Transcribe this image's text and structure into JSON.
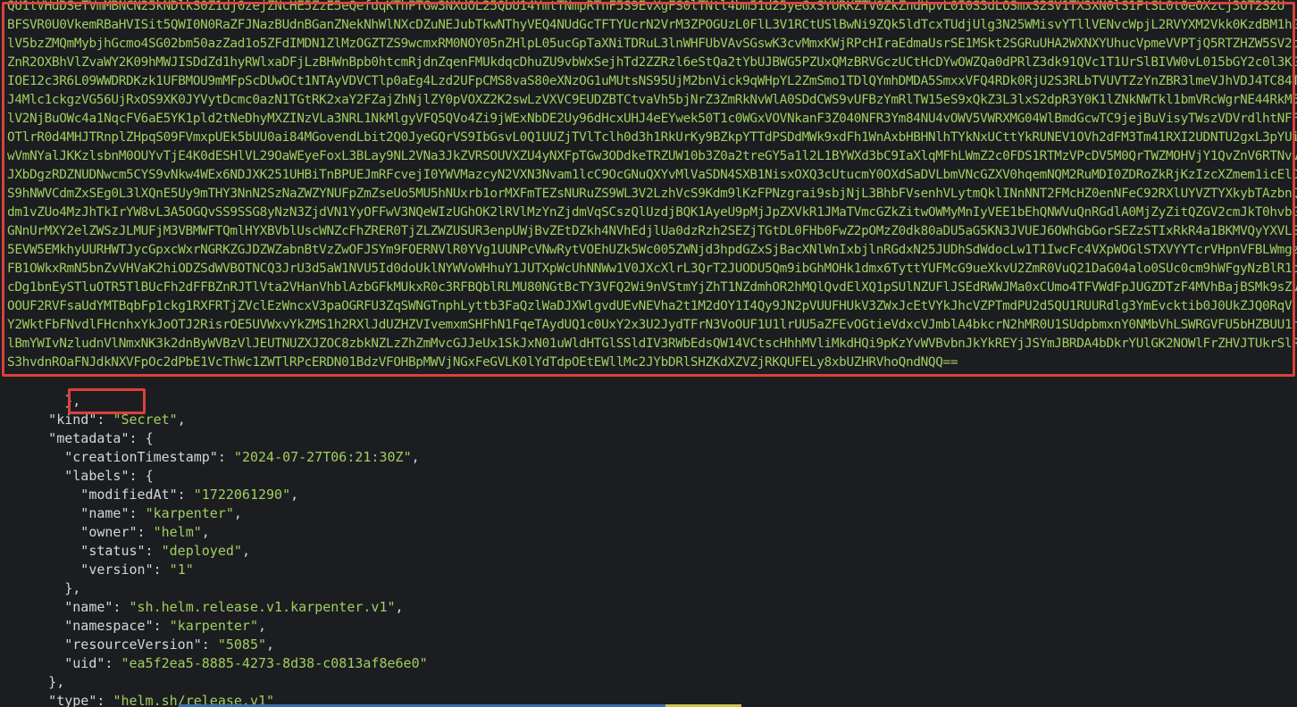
{
  "blob_lines": [
    "QU1tVHdDSeTVmMBNCN25kNDlkS0Z1dj0zejZNcHE5ZzE5eQefdqKThPTGw3NXdOL25QbU14YmtTNmpRTnF5S9EvXgFS0lTNtl4bm51d25yeGxSYURKZTV0ZkZndHpvL0I0S3dLOSmxS2SV1TX3XN0lS1FtSL0t0eOXzcj3OT2S2U",
    "BFSVR0U0VkemRBaHVISit5QWI0N0RaZFJNazBUdnBGanZNekNhWlNXcDZuNEJubTkwNThyVEQ4NUdGcTFTYUcrN2VrM3ZPOGUzL0FlL3V1RCtUSlBwNi9ZQk5ldTcxTUdjUlg3N25WMisvYTllVENvcWpjL2RVYXM2Vkk0KzdBM1hGeSt",
    "lV5bzZMQmMybjhGcmo4SG02bm50azZad1o5ZFdIMDN1ZlMzOGZTZS9wcmxRM0NOY05nZHlpL05ucGpTaXNiTDRuL3lnWHFUbVAvSGswK3cvMmxKWjRPcHIraEdmaUsrSE1MSkt2SGRuUHA2WXNXYUhucVpmeVVPTjQ5RTZHZW5SV2pGa",
    "ZnR2OXBhVlZvaWY2K09hMWJISDdZd1hyRWlxaDFjLzBHWnBpb0htcmRjdnZqenFMUkdqcDhuZU9vbWxSejhTd2ZZRzl6eStQa2tYbUJBWG5PZUxQMzBRVGczUCtHcDYwOWZQa0dPRlZ3dk91QVc1T1UrSlBIVW0vL015bGY2c0l3KGxhT",
    "IOE12c3R6L09WWDRDKzk1UFBMOU9mMFpScDUwOCt1NTAyVDVCTlp0aEg4Lzd2UFpCMS8vaS80eXNzOG1uMUtsNS95UjM2bnVick9qWHpYL2ZmSmo1TDlQYmhDMDA5SmxxVFQ4RDk0RjU2S3RLbTVUVTZzYnZBR3lmeVJhVDJ4TC84T3Q",
    "J4Mlc1ckgzVG56UjRxOS9XK0JYVytDcmc0azN1TGtRK2xaY2FZajZhNjlZY0pVOXZ2K2swLzVXVC9EUDZBTCtvaVh5bjNrZ3ZmRkNvWlA0SDdCWS9vUFBzYmRlTW15eS9xQkZ3L3lxS2dpR3Y0K1lZNkNWTkl1bmVRcWgrNE44RkM5S",
    "lV2NjBuOWc4a1NqcFV6aE5YK1pld2tNeDhyMXZINzVLa3NRL1NkMlgyVFQ5QVo4Zi9jWExNbDE2Uy96dHcxUHJ4eEYwek50T1c0WGxVOVNkanF3Z040NFR3Ym84NU4vOWV5VWRXMG04WlBmdGcwTC9jejBuVisyTWszVDVrdlhtNFFST",
    "OTlrR0d4MHJTRnplZHpqS09FVmxpUEk5bUU0ai84MGovendLbit2Q0JyeGQrVS9IbGsvL0Q1UUZjTVlTclh0d3h1RkUrKy9BZkpYTTdPSDdMWk9xdFh1WnAxbHBHNlhTYkNxUCttYkRUNEV1OVh2dFM3Tm41RXI2UDNTU2gxL3pYUi",
    "wVmNYalJKKzlsbnM0OUYvTjE4K0dESHlVL29OaWEyeFoxL3BLay9NL2VNa3JkZVRSOUVXZU4yNXFpTGw3ODdkeTRZUW10b3Z0a2treGY5a1l2L1BYWXd3bC9IaXlqMFhLWmZ2c0FDS1RTMzVPcDV5M0QrTWZMOHVjY1QvZnV6RTNvV",
    "JXbDgzRDZNUDNwcm5CYS9vNkw4WEx6NDJXK251UHBiTnBPUEJmRFcvejI0YWVMazcyN2VXN3Nvam1lcC9OcGNuQXYvMlVaSDN4SXB1NisxOXQ3cUtucmY0OXdSaDVLbmVNcGZXV0hqemNQM2RuMDI0ZDRoZkRjKzIzcXZmem1icElDR",
    "S9hNWVCdmZxSEg0L3lXQnE5Uy9mTHY3NnN2SzNaZWZYNUFpZmZseUo5MU5hNUxrb1orMXFmTEZsNURuZS9WL3V2LzhVcS9Kdm9lKzFPNzgrai9sbjNjL3BhbFVsenhVLytmQklINnNNT2FMcHZ0enNFeC92RXlUYVZTYXkybTAzbnQ",
    "dm1vZUo4MzJhTkIrYW8vL3A5OGQvSS9SSG8yNzN3ZjdVN1YyOFFwV3NQeWIzUGhOK2lRVlMzYnZjdmVqSCszQlUzdjBQK1AyeU9pMjJpZXVkR1JMaTVmcGZkZitwOWMyMnIyVEE1bEhQNWVuQnRGdlA0MjZyZitQZGV2cmJkT0hvbG",
    "GNnUrMXY2elZWSzJLMUFjM3VBMWFTQmlHYXBVblUscWNZcFhZRER0TjZLZWZUSUR3enpUWjBvZEtDZkh4NVhEdjlUa0dzRzh2SEZjTGtDL0FHb0FwZ2pOMzZ0dk80aDU5aG5KN3JVUEJ6OWhGbGorSEZzSTIxRkR4a1BKMVQyYXVLS",
    "5EVW5EMkhyUURHWTJycGpxcWxrNGRKZGJDZWZabnBtVzZwOFJSYm9FOERNVlR0YVg1UUNPcVNwRytVOEhUZk5Wc005ZWNjd3hpdGZxSjBacXNlWnIxbjlnRGdxN25JUDhSdWdocLw1T1IwcFc4VXpWOGlSTXVYYTcrVHpnVFBLWmgzZ",
    "FB1OWkxRmN5bnZvVHVaK2hiODZSdWVBOTNCQ3JrU3d5aW1NVU5Id0doUklNYWVoWHhuY1JUTXpWcUhNNWw1V0JXcXlrL3QrT2JUODU5Qm9ibGhMOHk1dmx6TyttYUFMcG9ueXkvU2ZmR0VuQ21DaG04alo0SUc0cm9hWFgyNzBlR1pt",
    "cDg1bnEySTluOTR5TlBUcFh2dFFBZnRJTlVta2VHanVhblAzbGFkMUkxR0c3RFBQblRLMU80NGtBcTY3VFQ2Wi9nVStmYjZhT1NZdmhOR2hMQlQvdElXQ1pSUlNZUFlJSEdRWWJMa0xCUmo4TFVWdFpJUGZDTzF4MVhBajBSMk9sZVV",
    "OOUF2RVFsaUdYMTBqbFp1ckg1RXFRTjZVclEzWncxV3paOGRFU3ZqSWNGTnphLyttb3FaQzlWaDJXWlgvdUEvNEVha2t1M2dOY1I4Qy9JN2pVUUFHUkV3ZWxJcEtVYkJhcVZPTmdPU2d5QU1RUURdlg3YmEvcktib0J0UkZJQ0RqV",
    "Y2WktFbFNvdlFHcnhxYkJoOTJ2RisrOE5UVWxvYkZMS1h2RXlJdUZHZVIvemxmSHFhN1FqeTAydUQ1c0UxY2x3U2JydTFrN3VoOUF1U1lrUU5aZFEvOGtieVdxcVJmblA4bkcrN2hMR0U1SUdpbmxnY0NMbVhLSWRGVFU5bHZBUU1nQ",
    "lBmYWIvNzludnVlNmxNK3k2dnByWVBzVlJEUTNUZXJZOC8zbkNZLzZhZmMvcGJJeUx1SkJxN01uWldHTGlSSldIV3RWbEdsQW14VCtscHhhMVliMkdHQi9pKzYvWVBvbnJkYkREYjJSYmJBRDA4bDkrYUlGK2NOWlFrZHVJTUkrSlR",
    "S3hvdnROaFNJdkNXVFpOc2dPbE1VcThWc1ZWTlRPcERDN01BdzVFOHBpMWVjNGxFeGVLK0lYdTdpOEtEWllMc2JYbDRlSHZKdXZVZjRKQUFELy8xbUZHRVhoQndNQQ=="
  ],
  "json_lines": [
    {
      "key": "",
      "punct_before": "    },",
      "value": ""
    },
    {
      "key": "kind",
      "value": "Secret"
    },
    {
      "key": "metadata",
      "value": "{"
    },
    {
      "key": "creationTimestamp",
      "value": "2024-07-27T06:21:30Z"
    },
    {
      "key": "labels",
      "value": "{"
    },
    {
      "key": "modifiedAt",
      "value": "1722061290"
    },
    {
      "key": "name",
      "value": "karpenter"
    },
    {
      "key": "owner",
      "value": "helm"
    },
    {
      "key": "status",
      "value": "deployed"
    },
    {
      "key": "version",
      "value": "1"
    },
    {
      "key": "",
      "punct_before": "    },",
      "value": ""
    },
    {
      "key": "name",
      "value": "sh.helm.release.v1.karpenter.v1"
    },
    {
      "key": "namespace",
      "value": "karpenter"
    },
    {
      "key": "resourceVersion",
      "value": "5085"
    },
    {
      "key": "uid",
      "value": "ea5f2ea5-8885-4273-8d38-c0813af8e6e0"
    },
    {
      "key": "",
      "punct_before": "  },",
      "value": ""
    },
    {
      "key": "type",
      "value": "helm.sh/release.v1"
    },
    {
      "key": "",
      "punct_before": "}",
      "value": ""
    }
  ],
  "colors": {
    "background": "#1c1d21",
    "string": "#9fcf5f",
    "key": "#d5d6d8",
    "highlight": "#d9423b"
  }
}
